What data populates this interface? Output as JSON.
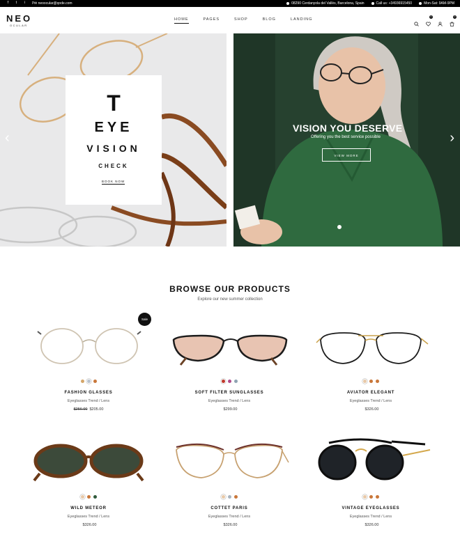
{
  "topbar": {
    "social": [
      "f",
      "t",
      "i",
      "p"
    ],
    "email": "neoocular@qode.com",
    "address": "08290 Cerdanyola del Vallès, Barcelona, Spain",
    "phone": "Call us: +34936915450",
    "hours": "Mon-Sat: 9AM-9PM"
  },
  "header": {
    "logo_main": "NEO",
    "logo_sub": "OCULAR",
    "nav": [
      "HOME",
      "PAGES",
      "SHOP",
      "BLOG",
      "LANDING"
    ],
    "active_nav": "HOME",
    "wishlist_count": "0",
    "cart_count": "0"
  },
  "hero_left": {
    "line1": "T",
    "line2": "EYE",
    "line3": "VISION",
    "line4": "CHECK",
    "button": "BOOK NOW"
  },
  "hero_right": {
    "title": "VISION YOU DESERVE",
    "subtitle": "Offering you the best service possible",
    "button": "VIEW MORE"
  },
  "section": {
    "title": "BROWSE OUR PRODUCTS",
    "subtitle": "Explore our new summer collection",
    "sale_badge": "Sale"
  },
  "products": [
    {
      "name": "FASHION GLASSES",
      "category": "Eyeglasses Trend / Lens",
      "old_price": "$256.00",
      "price": "$205.00",
      "swatches": [
        "#d4a66a",
        "#b9c3cf",
        "#c9773a"
      ]
    },
    {
      "name": "SOFT FILTER SUNGLASSES",
      "category": "Eyeglasses Trend / Lens",
      "old_price": "",
      "price": "$299.00",
      "swatches": [
        "#c0392b",
        "#b04a8c",
        "#8fa3b3"
      ]
    },
    {
      "name": "AVIATOR ELEGANT",
      "category": "Eyeglasses Trend / Lens",
      "old_price": "",
      "price": "$326.00",
      "swatches": [
        "#e8c9a8",
        "#c9773a",
        "#c9773a"
      ]
    },
    {
      "name": "WILD METEOR",
      "category": "Eyeglasses Trend / Lens",
      "old_price": "",
      "price": "$326.00",
      "swatches": [
        "#e8c9a8",
        "#c9773a",
        "#2f5a3c"
      ]
    },
    {
      "name": "COTTET PARIS",
      "category": "Eyeglasses Trend / Lens",
      "old_price": "",
      "price": "$326.00",
      "swatches": [
        "#e8c9a8",
        "#a8b4bf",
        "#c9773a"
      ]
    },
    {
      "name": "VINTAGE EYEGLASSES",
      "category": "Eyeglasses Trend / Lens",
      "old_price": "",
      "price": "$326.00",
      "swatches": [
        "#e8c9a8",
        "#c9773a",
        "#c9773a"
      ]
    }
  ]
}
